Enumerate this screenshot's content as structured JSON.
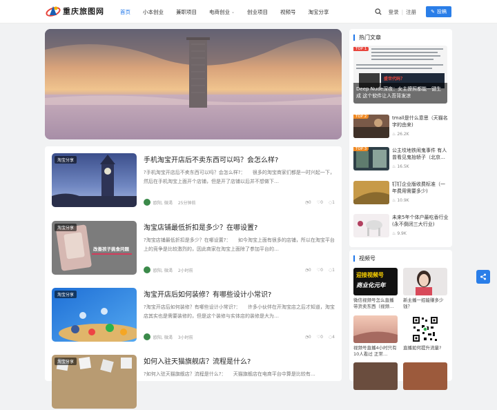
{
  "brand": {
    "logo_text": "重庆旅图网"
  },
  "nav": {
    "items": [
      {
        "label": "首页"
      },
      {
        "label": "小本创业"
      },
      {
        "label": "兼职项目"
      },
      {
        "label": "电商创业"
      },
      {
        "label": "创业项目"
      },
      {
        "label": "视频号"
      },
      {
        "label": "淘宝分享"
      }
    ]
  },
  "header_right": {
    "login": "登录",
    "register": "注册",
    "post_button": "投稿"
  },
  "posts": [
    {
      "tag": "淘宝分享",
      "title": "手机淘宝开店后不卖东西可以吗？会怎么样?",
      "excerpt": "?手机淘宝开店后不卖东西可以吗？会怎么样?：　　很多的淘宝商家们都是一时兴起一下，然后在手机淘宝上面开个店铺，但是开了店铺以后并不想做下…",
      "author": "欧阳, 微渴",
      "time": "25分钟前",
      "views": "0",
      "likes": "0",
      "comments": "1"
    },
    {
      "tag": "淘宝分享",
      "thumb_caption": "改善孩子挑食问题",
      "title": "淘宝店铺最低折扣是多少？在哪设置?",
      "excerpt": "?淘宝店铺最低折扣是多少？在哪设置?：　　如今淘宝上面有很多的店铺，所以在淘宝平台上的竞争是比较激烈的，因此商家在淘宝上面除了参加平台的…",
      "author": "欧阳, 微渴",
      "time": "2小时前",
      "views": "0",
      "likes": "0",
      "comments": "1"
    },
    {
      "tag": "淘宝分享",
      "title": "淘宝开店后如何装修？有哪些设计小常识?",
      "excerpt": "?淘宝开店后如何装修？有哪些设计小常识?：　　许多小伙伴在开淘宝店之后才知道，淘宝店其实也是需要装修的，但是这个装修与实体店的装修是大为…",
      "author": "欧阳, 微渴",
      "time": "3小时前",
      "views": "0",
      "likes": "0",
      "comments": "4"
    },
    {
      "tag": "淘宝分享",
      "title": "如何入驻天猫旗舰店？流程是什么?",
      "excerpt": "?如何入驻天猫旗舰店？流程是什么?：　　天猫旗舰店在电商平台中算是比较有…",
      "author": "欧阳, 微渴",
      "time": "",
      "views": "0",
      "likes": "0",
      "comments": "0"
    }
  ],
  "sidebar": {
    "hot_title": "热门文章",
    "hot_feature": {
      "rank": "TOP 1",
      "title": "Deep Nude深夜：女主撩照都能一键生成 这个软件让人吾背发凉",
      "stamp": "盛世代码？"
    },
    "hot_items": [
      {
        "rank": "TOP 2",
        "title": "tmall是什么意思（天猫名字的由来)",
        "count": "26.2K"
      },
      {
        "rank": "TOP 3",
        "title": "公主坟地铁闹鬼事件 有人曾看见鬼抬轿子（北京…",
        "count": "16.5K"
      },
      {
        "rank": "",
        "title": "钉钉企业版收费标准（一年费用需要多少)",
        "count": "10.9K"
      },
      {
        "rank": "",
        "title": "未来5年个体户最吃香行业(永不倒闭三大行业)",
        "count": "9.9K"
      }
    ],
    "video_title": "视频号",
    "videos": [
      {
        "title": "微信视频号怎么直播带货卖东西（视频…",
        "overlay1": "迎接视频号",
        "overlay2": "商业化元年"
      },
      {
        "title": "新主播一招能赚多少钱？"
      },
      {
        "title": "视频号直播4小时只有10人看过 正常…"
      },
      {
        "title": "直播如何提升流量?"
      }
    ]
  },
  "colors": {
    "accent": "#1a73e8",
    "rank_red": "#e8453c",
    "rank_orange": "#f08a24"
  }
}
